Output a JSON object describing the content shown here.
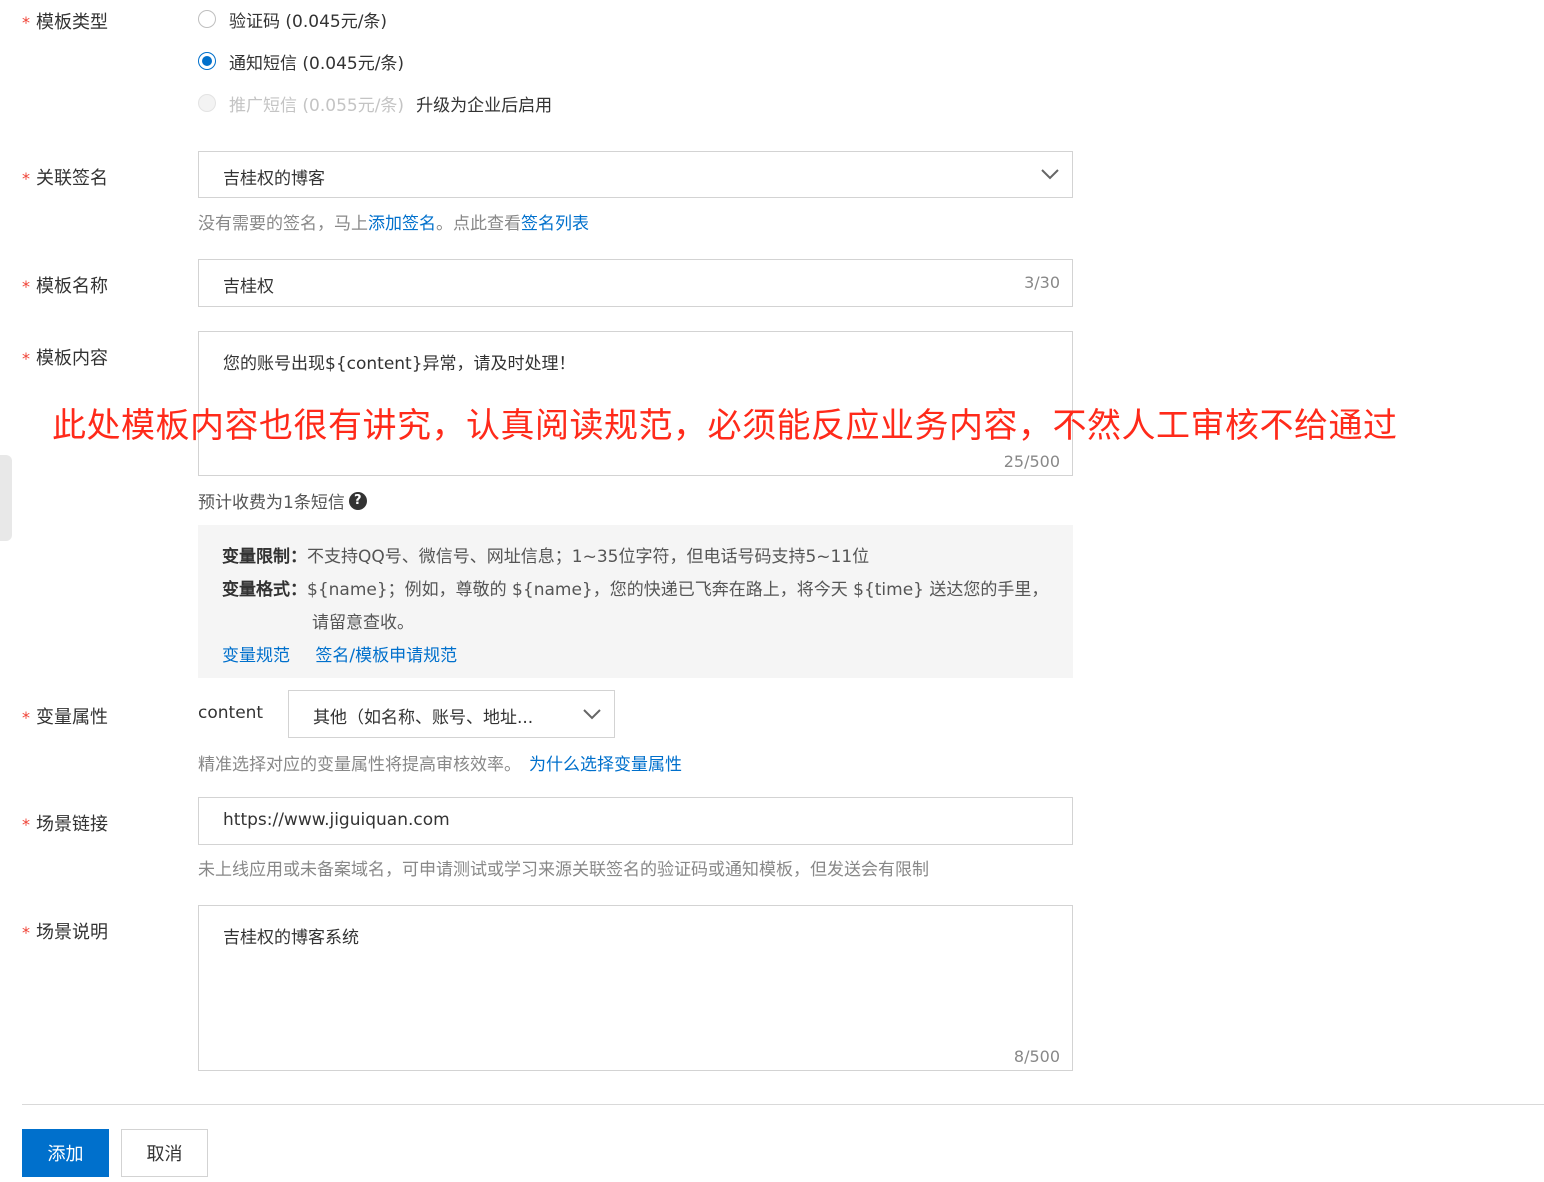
{
  "form": {
    "template_type": {
      "label": "模板类型",
      "options": [
        {
          "text": "验证码 (0.045元/条)",
          "checked": false,
          "disabled": false
        },
        {
          "text": "通知短信 (0.045元/条)",
          "checked": true,
          "disabled": false
        },
        {
          "text": "推广短信 (0.055元/条)",
          "checked": false,
          "disabled": true
        }
      ],
      "upgrade_note": "升级为企业后启用"
    },
    "signature": {
      "label": "关联签名",
      "value": "吉桂权的博客",
      "hint_prefix": "没有需要的签名，马上",
      "hint_link1": "添加签名",
      "hint_mid": "。点此查看",
      "hint_link2": "签名列表"
    },
    "template_name": {
      "label": "模板名称",
      "value": "吉桂权",
      "counter": "3/30"
    },
    "template_content": {
      "label": "模板内容",
      "value": "您的账号出现${content}异常，请及时处理！",
      "counter": "25/500",
      "estimate": "预计收费为1条短信"
    },
    "annotation": "此处模板内容也很有讲究，认真阅读规范，必须能反应业务内容，不然人工审核不给通过",
    "rules": {
      "limit_label": "变量限制：",
      "limit_text": "不支持QQ号、微信号、网址信息；1~35位字符，但电话号码支持5~11位",
      "format_label": "变量格式：",
      "format_text": "${name}；例如，尊敬的 ${name}，您的快递已飞奔在路上，将今天 ${time} 送达您的手里，",
      "format_text2": "请留意查收。",
      "link1": "变量规范",
      "link2": "签名/模板申请规范"
    },
    "variable_attr": {
      "label": "变量属性",
      "var_name": "content",
      "selected": "其他（如名称、账号、地址...",
      "hint": "精准选择对应的变量属性将提高审核效率。",
      "hint_link": "为什么选择变量属性"
    },
    "scene_link": {
      "label": "场景链接",
      "value": "https://www.jiguiquan.com",
      "hint": "未上线应用或未备案域名，可申请测试或学习来源关联签名的验证码或通知模板，但发送会有限制"
    },
    "scene_desc": {
      "label": "场景说明",
      "value": "吉桂权的博客系统",
      "counter": "8/500"
    },
    "buttons": {
      "submit": "添加",
      "cancel": "取消"
    },
    "required_mark": "*"
  },
  "colors": {
    "primary": "#0070cc",
    "required": "#f04134",
    "annotation": "#ff2a1a"
  }
}
